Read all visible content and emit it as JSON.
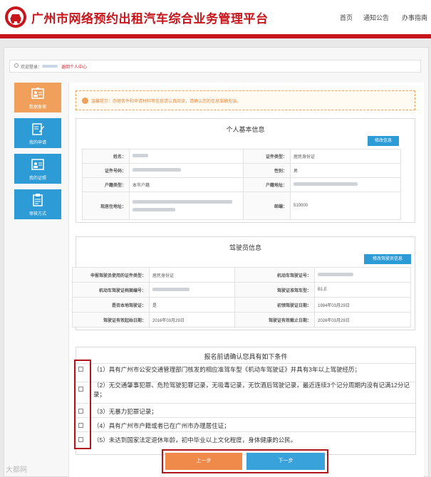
{
  "header": {
    "site_title": "广州市网络预约出租汽车综合业务管理平台",
    "nav": [
      "首页",
      "通知公告",
      "办事指南"
    ]
  },
  "welcome": {
    "label": "欢迎登录：",
    "link": "返回个人中心"
  },
  "sidebar": {
    "items": [
      {
        "label": "数据备案",
        "icon": "id-card-icon"
      },
      {
        "label": "我的申请",
        "icon": "edit-doc-icon"
      },
      {
        "label": "我的证照",
        "icon": "license-icon"
      },
      {
        "label": "审核方式",
        "icon": "clipboard-icon"
      }
    ]
  },
  "notice": {
    "text": "温馨提示：办理条件和申请材料等信息请认真阅读，请确认您的信息准确无误。"
  },
  "personal": {
    "title": "个人基本信息",
    "modify_button": "修改信息",
    "rows": [
      {
        "l1": "姓名：",
        "v1": "",
        "l2": "证件类型：",
        "v2": "居民身份证"
      },
      {
        "l1": "证件号码：",
        "v1": "",
        "l2": "性别：",
        "v2": "男"
      },
      {
        "l1": "户籍类型：",
        "v1": "本市户籍",
        "l2": "户籍地址：",
        "v2": ""
      },
      {
        "l1": "现居住地址：",
        "v1": "",
        "l2": "邮编：",
        "v2": "510000"
      }
    ]
  },
  "driver": {
    "title": "驾驶员信息",
    "modify_button": "修改驾驶员信息",
    "rows": [
      {
        "l1": "申报驾驶员使用的证件类型：",
        "v1": "居民身份证",
        "l2": "机动车驾驶证号：",
        "v2": ""
      },
      {
        "l1": "机动车驾驶证档案编号：",
        "v1": "",
        "l2": "驾驶证准驾车型：",
        "v2": "B1,E"
      },
      {
        "l1": "是否本地驾驶证：",
        "v1": "是",
        "l2": "初领驾驶证日期：",
        "v2": "1994年03月29日"
      },
      {
        "l1": "驾驶证有效起始日期：",
        "v1": "2016年03月29日",
        "l2": "驾驶证有效截止日期：",
        "v2": "2026年03月29日"
      }
    ]
  },
  "conditions": {
    "title": "报名前请确认您具有如下条件",
    "items": [
      "（1）具有广州市公安交通管理部门核发的相应准驾车型《机动车驾驶证》并具有3年以上驾驶经历；",
      "（2）无交通肇事犯罪、危险驾驶犯罪记录，无吸毒记录，无饮酒后驾驶记录，最近连续3个记分周期内没有记满12分记录；",
      "（3）无暴力犯罪记录；",
      "（4）具有广州市户籍或者已在广州市办理居住证；",
      "（5）未达到国家法定退休年龄，初中毕业以上文化程度，身体健康的公民。"
    ]
  },
  "buttons": {
    "prev": "上一步",
    "next": "下一步"
  },
  "colors": {
    "brand_red": "#c8161d",
    "accent_blue": "#2c9bd6",
    "accent_orange": "#f0a05a"
  },
  "watermark": "大都网"
}
